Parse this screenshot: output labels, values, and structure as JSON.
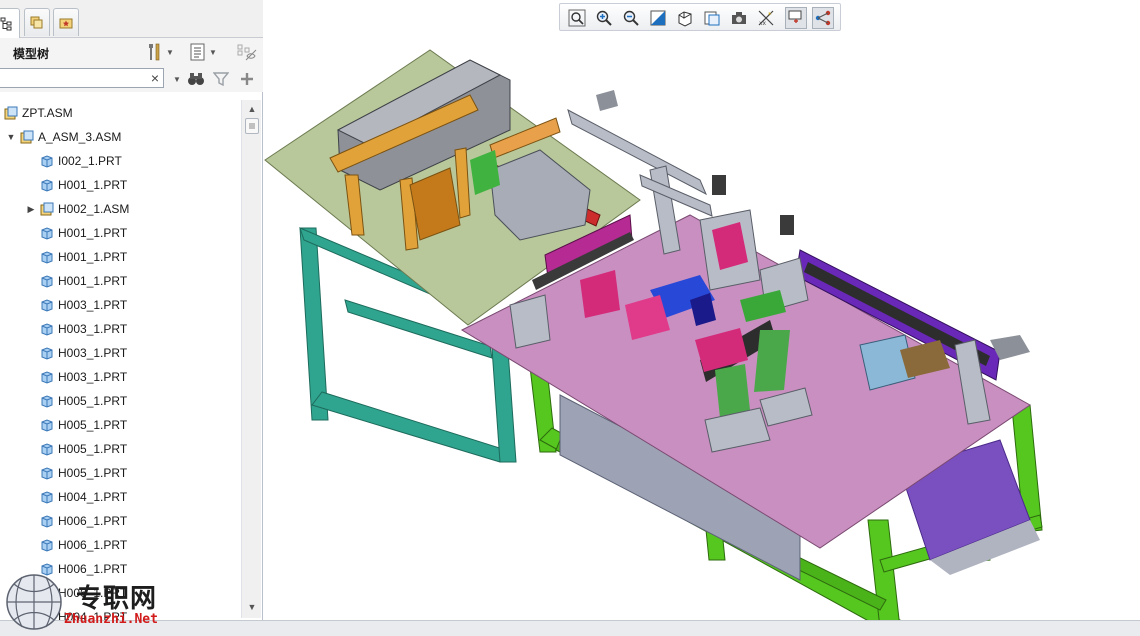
{
  "panel": {
    "tab_names": [
      "model-tree-tab",
      "layers-tab",
      "favorites-tab"
    ],
    "title": "模型树"
  },
  "search": {
    "value": "",
    "placeholder": "",
    "clear_label": "×"
  },
  "tree": {
    "items": [
      {
        "label": "ZPT.ASM",
        "type": "asm",
        "level": 0,
        "expander": ""
      },
      {
        "label": "A_ASM_3.ASM",
        "type": "asm",
        "level": 1,
        "expander": "▼"
      },
      {
        "label": "I002_1.PRT",
        "type": "prt",
        "level": 2,
        "expander": ""
      },
      {
        "label": "H001_1.PRT",
        "type": "prt",
        "level": 2,
        "expander": ""
      },
      {
        "label": "H002_1.ASM",
        "type": "asm",
        "level": 2,
        "expander": "▶"
      },
      {
        "label": "H001_1.PRT",
        "type": "prt",
        "level": 2,
        "expander": ""
      },
      {
        "label": "H001_1.PRT",
        "type": "prt",
        "level": 2,
        "expander": ""
      },
      {
        "label": "H001_1.PRT",
        "type": "prt",
        "level": 2,
        "expander": ""
      },
      {
        "label": "H003_1.PRT",
        "type": "prt",
        "level": 2,
        "expander": ""
      },
      {
        "label": "H003_1.PRT",
        "type": "prt",
        "level": 2,
        "expander": ""
      },
      {
        "label": "H003_1.PRT",
        "type": "prt",
        "level": 2,
        "expander": ""
      },
      {
        "label": "H003_1.PRT",
        "type": "prt",
        "level": 2,
        "expander": ""
      },
      {
        "label": "H005_1.PRT",
        "type": "prt",
        "level": 2,
        "expander": ""
      },
      {
        "label": "H005_1.PRT",
        "type": "prt",
        "level": 2,
        "expander": ""
      },
      {
        "label": "H005_1.PRT",
        "type": "prt",
        "level": 2,
        "expander": ""
      },
      {
        "label": "H005_1.PRT",
        "type": "prt",
        "level": 2,
        "expander": ""
      },
      {
        "label": "H004_1.PRT",
        "type": "prt",
        "level": 2,
        "expander": ""
      },
      {
        "label": "H006_1.PRT",
        "type": "prt",
        "level": 2,
        "expander": ""
      },
      {
        "label": "H006_1.PRT",
        "type": "prt",
        "level": 2,
        "expander": ""
      },
      {
        "label": "H006_1.PRT",
        "type": "prt",
        "level": 2,
        "expander": ""
      },
      {
        "label": "H006_1.PRT",
        "type": "prt",
        "level": 2,
        "expander": ""
      },
      {
        "label": "H004_1.PRT",
        "type": "prt",
        "level": 2,
        "expander": ""
      }
    ]
  },
  "scrollbar": {
    "up": "▲",
    "down": "▼"
  },
  "toolbar": {
    "buttons": [
      "refit-icon",
      "zoom-in-icon",
      "zoom-out-icon",
      "repaint-icon",
      "display-style-icon",
      "saved-views-icon",
      "view-manager-icon",
      "datum-display-icon",
      "spin-center-icon",
      "annotation-display-icon"
    ]
  },
  "colors": {
    "accent": "#1f6fbf",
    "left_table_top": "#b8c89a",
    "left_table_frame": "#2fa58f",
    "right_table_top": "#c98fc0",
    "right_table_frame": "#55c71f",
    "conveyor": "#6a28b8"
  },
  "watermark": {
    "cn": "专职网",
    "en": "Zhuanzhi.Net"
  }
}
